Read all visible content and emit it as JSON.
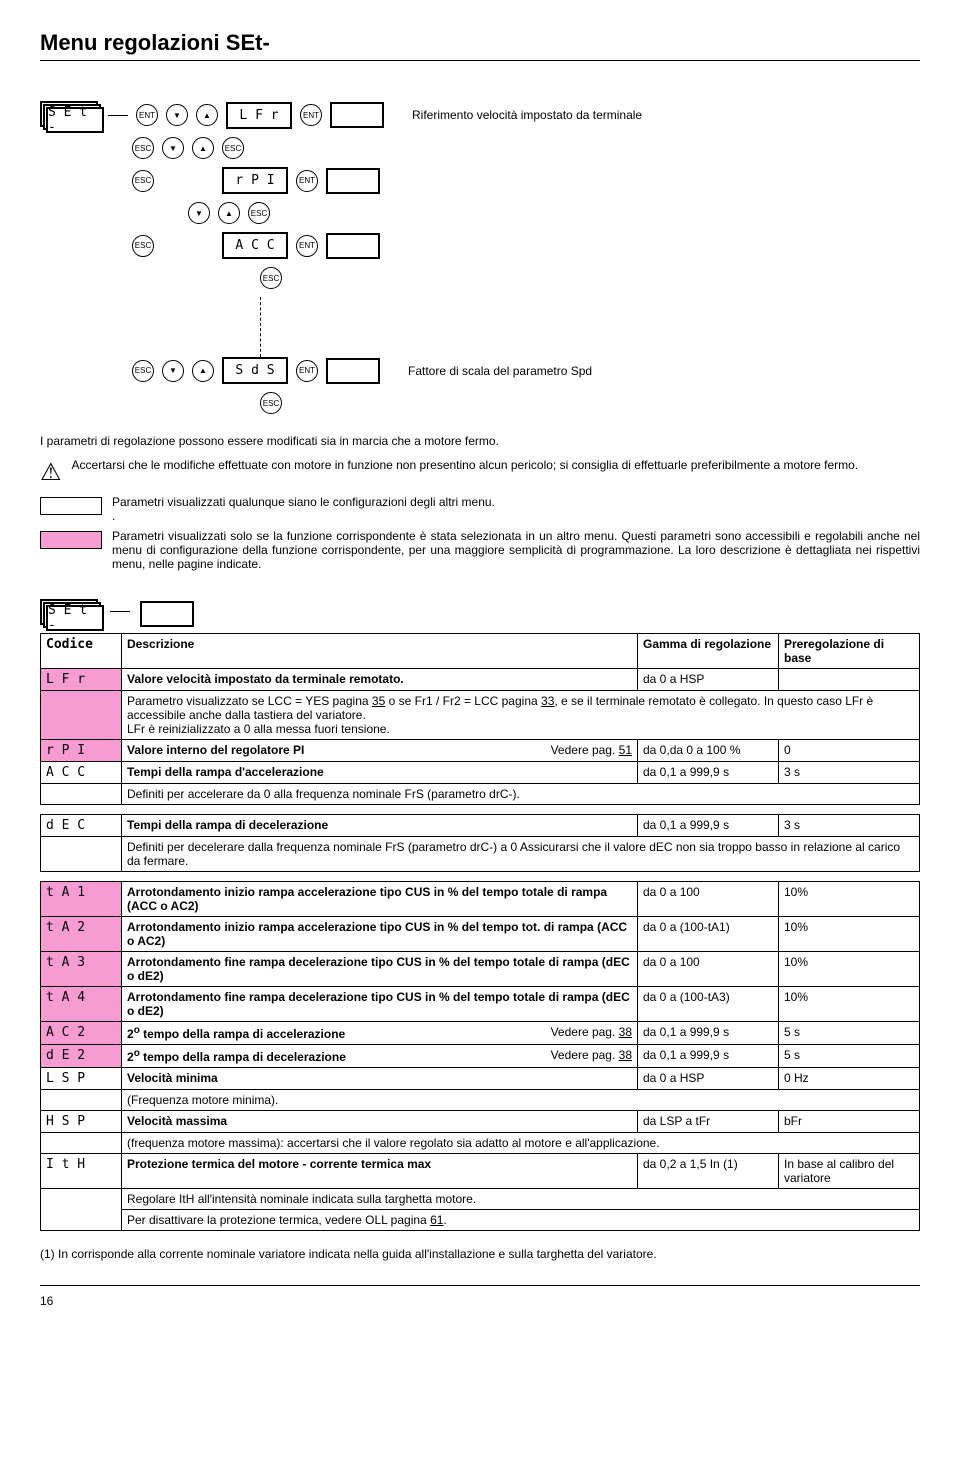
{
  "title": "Menu regolazioni SEt-",
  "diagram": {
    "menu_code": "S E t -",
    "rows": [
      {
        "code": "L F r",
        "label": "Riferimento velocità impostato da terminale"
      },
      {
        "code": "r P I",
        "label": ""
      },
      {
        "code": "A C C",
        "label": ""
      },
      {
        "code": "S d S",
        "label": "Fattore di scala del parametro Spd"
      }
    ],
    "ent": "ENT",
    "esc": "ESC",
    "up": "▲",
    "down": "▼"
  },
  "notes": {
    "intro": "I parametri di regolazione possono essere modificati sia in marcia che a motore fermo.",
    "warn": "Accertarsi che le modifiche effettuate con motore in funzione non presentino alcun pericolo; si consiglia di effettuarle preferibilmente a motore fermo.",
    "legend_white": "Parametri visualizzati qualunque siano le configurazioni degli altri menu.",
    "legend_pink": "Parametri visualizzati solo se la funzione corrispondente è stata selezionata in un altro menu. Questi parametri sono accessibili e regolabili anche nel menu di configurazione della funzione corrispondente, per una maggiore semplicità di programmazione. La loro descrizione è dettagliata nei rispettivi menu, nelle pagine indicate."
  },
  "second_diagram_code": "S E t -",
  "table_headers": {
    "code": "Codice",
    "desc": "Descrizione",
    "range": "Gamma di regolazione",
    "preset": "Preregolazione di base"
  },
  "rows": {
    "lfr": {
      "code": "L F r",
      "desc": "Valore velocità impostato da terminale remotato.",
      "range": "da 0 a HSP",
      "note": "Parametro visualizzato se LCC = YES pagina 35 o se Fr1 / Fr2 = LCC pagina 33, e se il terminale remotato è collegato. In questo caso LFr è accessibile anche dalla tastiera del variatore.\nLFr è reinizializzato a 0 alla messa fuori tensione.",
      "pg1": "35",
      "pg2": "33"
    },
    "rpi": {
      "code": "r P I",
      "desc": "Valore interno del regolatore PI",
      "see": "Vedere pag. ",
      "pg": "51",
      "range": "da 0,da 0 a 100 %",
      "preset": "0"
    },
    "acc": {
      "code": "A C C",
      "desc": "Tempi della rampa d'accelerazione",
      "range": "da 0,1 a 999,9 s",
      "preset": "3 s",
      "note": "Definiti per accelerare da  0 alla frequenza nominale FrS (parametro  drC-)."
    },
    "dec": {
      "code": "d E C",
      "desc": "Tempi della rampa di decelerazione",
      "range": "da 0,1 a 999,9 s",
      "preset": "3 s",
      "note": "Definiti per decelerare dalla  frequenza nominale FrS (parametro  drC-) a 0 Assicurarsi che il valore dEC non sia troppo basso in relazione al carico da fermare."
    },
    "ta1": {
      "code": "t A 1",
      "desc": "Arrotondamento inizio rampa accelerazione tipo CUS in % del tempo totale di rampa (ACC o AC2)",
      "range": "da 0 a 100",
      "preset": "10%"
    },
    "ta2": {
      "code": "t A 2",
      "desc": "Arrotondamento inizio rampa accelerazione tipo CUS in % del tempo tot. di rampa (ACC o AC2)",
      "range": "da 0 a (100-tA1)",
      "preset": "10%"
    },
    "ta3": {
      "code": "t A 3",
      "desc": "Arrotondamento fine rampa decelerazione tipo CUS in % del tempo totale di rampa (dEC o dE2)",
      "range": "da 0 a 100",
      "preset": "10%"
    },
    "ta4": {
      "code": "t A 4",
      "desc": "Arrotondamento fine rampa decelerazione tipo CUS in % del tempo totale di rampa (dEC o dE2)",
      "range": "da 0 a (100-tA3)",
      "preset": "10%"
    },
    "ac2": {
      "code": "A C 2",
      "desc": "2o tempo della rampa di accelerazione",
      "see": "Vedere pag. ",
      "pg": "38",
      "range": "da 0,1 a 999,9 s",
      "preset": "5 s"
    },
    "de2": {
      "code": "d E 2",
      "desc": "2o tempo della rampa di decelerazione",
      "see": "Vedere pag. ",
      "pg": "38",
      "range": "da 0,1 a 999,9 s",
      "preset": "5 s"
    },
    "lsp": {
      "code": "L S P",
      "desc": "Velocità minima",
      "range": "da 0 a HSP",
      "preset": "0 Hz",
      "note": "(Frequenza motore minima)."
    },
    "hsp": {
      "code": "H S P",
      "desc": "Velocità massima",
      "range": "da LSP a tFr",
      "preset": "bFr",
      "note": "(frequenza motore massima): accertarsi che il valore regolato sia adatto al motore e all'applicazione."
    },
    "ith": {
      "code": "I t H",
      "desc": "Protezione termica del motore - corrente termica max",
      "range": "da 0,2 a 1,5 In (1)",
      "preset": "In base al calibro del variatore",
      "note1": "Regolare ItH all'intensità nominale indicata sulla targhetta motore.",
      "note2": "Per disattivare la protezione termica, vedere OLL pagina 61.",
      "pg": "61"
    }
  },
  "footnote": "(1) In corrisponde alla corrente nominale variatore indicata nella guida all'installazione e sulla targhetta del variatore.",
  "page_number": "16"
}
